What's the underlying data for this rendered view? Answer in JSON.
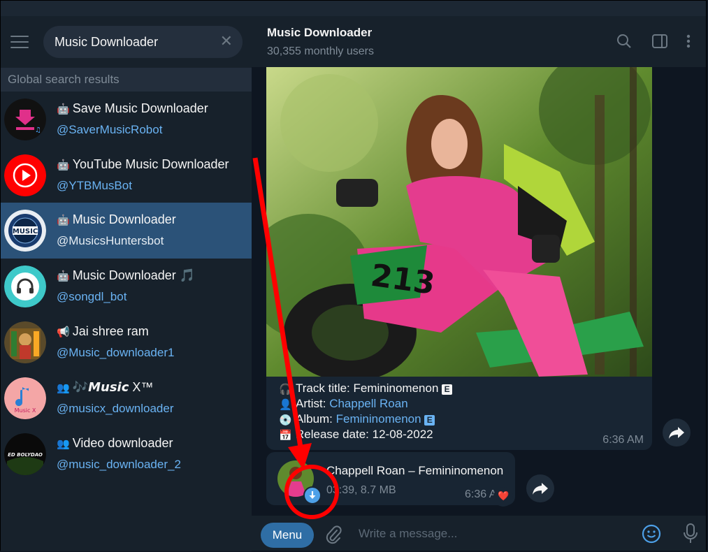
{
  "sidebar": {
    "search": {
      "value": "Music Downloader"
    },
    "section_title": "Global search results",
    "results": [
      {
        "name": "Save Music Downloader",
        "handle": "@SaverMusicRobot",
        "type_icon": "bot-icon"
      },
      {
        "name": "YouTube Music Downloader",
        "handle": "@YTBMusBot",
        "type_icon": "bot-icon"
      },
      {
        "name": "Music Downloader",
        "handle": "@MusicsHuntersbot",
        "type_icon": "bot-icon",
        "active": true
      },
      {
        "name": "Music Downloader 🎵",
        "handle": "@songdl_bot",
        "type_icon": "bot-icon"
      },
      {
        "name": "Jai shree ram",
        "handle": "@Music_downloader1",
        "type_icon": "channel-icon"
      },
      {
        "name": "🎶𝙈𝙪𝙨𝙞𝙘 X™",
        "handle": "@musicx_downloader",
        "type_icon": "group-icon"
      },
      {
        "name": "Video downloader",
        "handle": "@music_downloader_2",
        "type_icon": "group-icon"
      }
    ],
    "avatar_texts": {
      "music": "MUSIC",
      "musicx": "Music X",
      "video": "ED BOLYDAO"
    }
  },
  "chat": {
    "title": "Music Downloader",
    "subtitle": "30,355 monthly users",
    "message1": {
      "track_label": "Track title:",
      "track_value": "Femininomenon",
      "artist_label": "Artist:",
      "artist_value": "Chappell Roan",
      "album_label": "Album:",
      "album_value": "Femininomenon",
      "release_label": "Release date:",
      "release_value": "12-08-2022",
      "explicit_badge": "E",
      "time": "6:36 AM"
    },
    "message2": {
      "title": "Chappell Roan – Femininomenon",
      "meta": "03:39, 8.7 MB",
      "time": "6:36 AM",
      "reaction": "❤️"
    }
  },
  "composer": {
    "menu_label": "Menu",
    "placeholder": "Write a message..."
  },
  "colors": {
    "accent": "#6ab3f3",
    "active_item": "#2b5278",
    "annotation": "#ff0000"
  }
}
